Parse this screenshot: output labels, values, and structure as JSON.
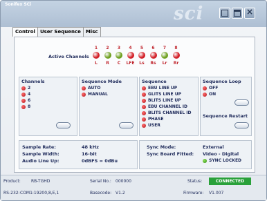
{
  "window": {
    "title": "Sonifex SCi",
    "logo": "sci"
  },
  "tabs": [
    "Control",
    "User Sequence",
    "Misc"
  ],
  "active_channels": {
    "label": "Active Channels",
    "numbers": [
      "1",
      "2",
      "3",
      "4",
      "5",
      "6",
      "7",
      "8"
    ],
    "letters": [
      "L",
      "R",
      "C",
      "LFE",
      "Ls",
      "Rs",
      "Lr",
      "Rr"
    ],
    "led_colors": [
      "#d21e26",
      "#6fa020",
      "#6fa020",
      "#d21e26",
      "#d21e26",
      "#d21e26",
      "#6fa020",
      "#d21e26"
    ]
  },
  "channels": {
    "title": "Channels",
    "items": [
      "2",
      "4",
      "6",
      "8"
    ]
  },
  "sequence_mode": {
    "title": "Sequence Mode",
    "items": [
      "AUTO",
      "MANUAL"
    ]
  },
  "sequence": {
    "title": "Sequence",
    "items": [
      "EBU LINE UP",
      "GLITS LINE UP",
      "BLITS LINE UP",
      "EBU CHANNEL ID",
      "BLITS CHANNEL ID",
      "PHASE",
      "USER"
    ]
  },
  "sequence_loop": {
    "title": "Sequence Loop",
    "items": [
      "OFF",
      "ON"
    ]
  },
  "sequence_restart": {
    "title": "Sequence Restart"
  },
  "audio_info": {
    "sample_rate_label": "Sample Rate:",
    "sample_rate": "48 kHz",
    "sample_width_label": "Sample Width:",
    "sample_width": "16-bit",
    "line_up_label": "Audio Line Up:",
    "line_up": "0dBFS = 0dBu"
  },
  "sync_info": {
    "mode_label": "Sync Mode:",
    "mode": "External",
    "board_label": "Sync Board Fitted:",
    "board": "Video - Digital",
    "locked": "SYNC LOCKED"
  },
  "status_bar": {
    "product_label": "Product:",
    "product": "RB-TGHD",
    "serial_label": "Serial No.:",
    "serial": "000000",
    "status_label": "Status:",
    "status": "CONNECTED",
    "rs232_label": "RS-232:",
    "rs232": "COM1:19200,8,E,1",
    "basecode_label": "Basecode:",
    "basecode": "V1.2",
    "firmware_label": "Firmware:",
    "firmware": "V1.007"
  }
}
